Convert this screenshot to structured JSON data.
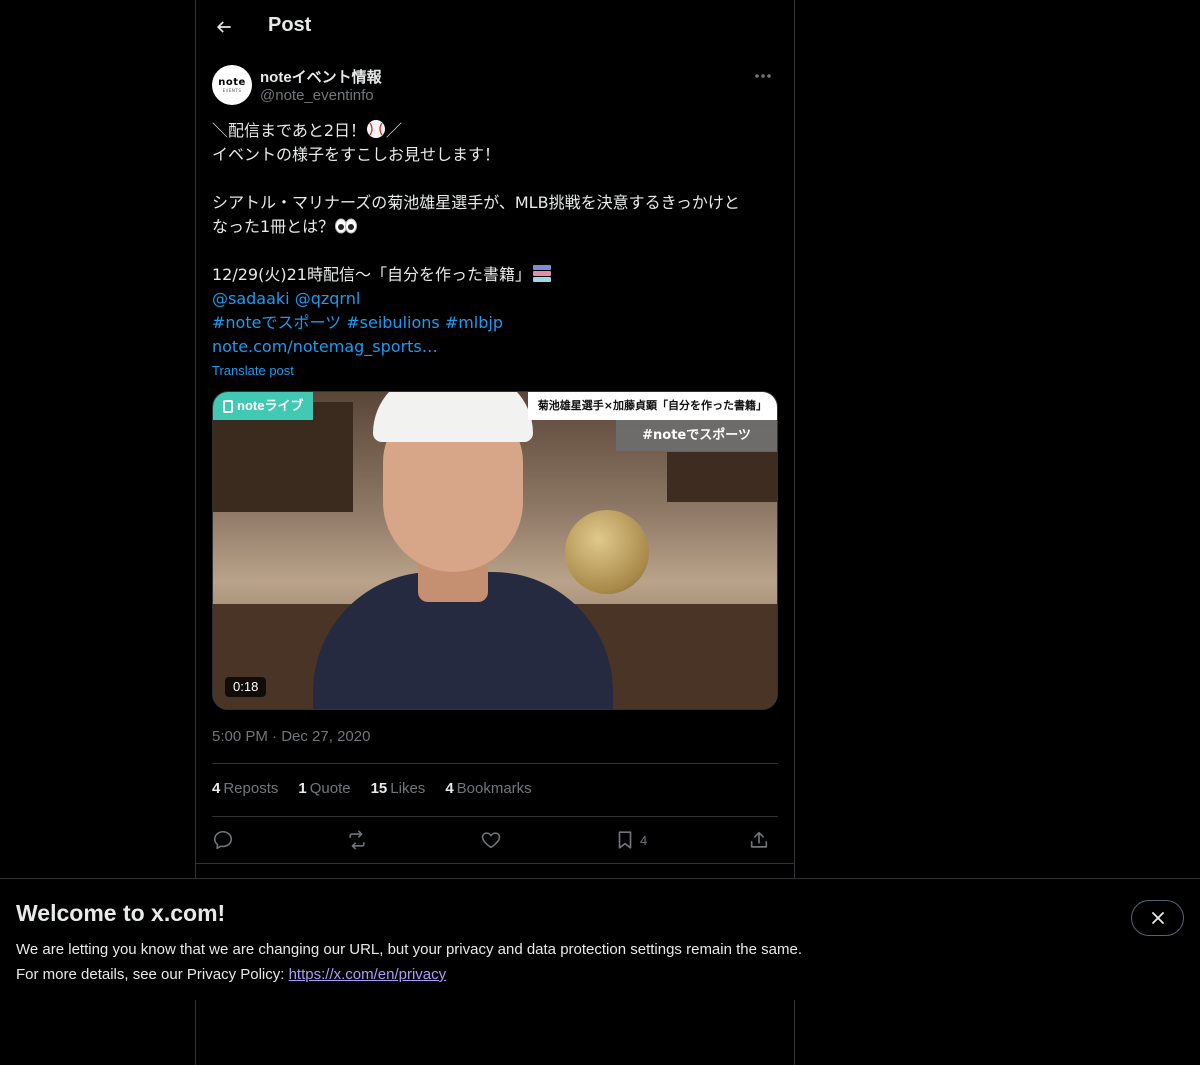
{
  "header": {
    "title": "Post"
  },
  "author": {
    "display_name": "noteイベント情報",
    "handle": "@note_eventinfo",
    "avatar_logo": "note",
    "avatar_sub": "EVENTS"
  },
  "post": {
    "line1_pre": "＼配信まであと2日！",
    "line1_post": "／",
    "line2": "イベントの様子をすこしお見せします！",
    "line3": "シアトル・マリナーズの菊池雄星選手が、MLB挑戦を決意するきっかけと",
    "line4": "なった1冊とは？",
    "line5": "12/29(火)21時配信〜「自分を作った書籍」",
    "mentions": [
      "@sadaaki",
      "@qzqrnl"
    ],
    "hashtags": [
      "#noteでスポーツ",
      "#seibulions",
      "#mlbjp"
    ],
    "link": "note.com/notemag_sports…",
    "translate": "Translate post"
  },
  "media": {
    "brand_tag": "noteライブ",
    "title_tag": "菊池雄星選手×加藤貞顕「自分を作った書籍」",
    "hash_tag": "#noteでスポーツ",
    "duration": "0:18"
  },
  "timestamp": {
    "time": "5:00 PM",
    "sep": "·",
    "date": "Dec 27, 2020"
  },
  "stats": {
    "reposts_count": "4",
    "reposts_label": "Reposts",
    "quotes_count": "1",
    "quotes_label": "Quote",
    "likes_count": "15",
    "likes_label": "Likes",
    "bookmarks_count": "4",
    "bookmarks_label": "Bookmarks"
  },
  "actions": {
    "bookmark_count": "4"
  },
  "banner": {
    "title": "Welcome to x.com!",
    "line1": "We are letting you know that we are changing our URL, but your privacy and data protection settings remain the same.",
    "line2": "For more details, see our Privacy Policy: ",
    "link": "https://x.com/en/privacy"
  },
  "colors": {
    "accent": "#1d9bf0",
    "muted": "#71767b",
    "note_green": "#41c9b4"
  }
}
